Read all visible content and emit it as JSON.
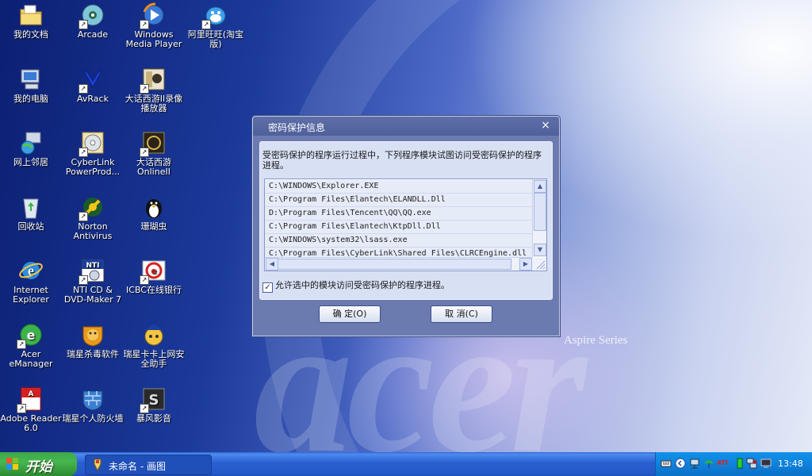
{
  "desktop": {
    "brand_text": "Aspire Series",
    "icons": [
      {
        "name": "my-documents",
        "label": "我的文档"
      },
      {
        "name": "arcade",
        "label": "Arcade"
      },
      {
        "name": "windows-media-player",
        "label": "Windows Media Player"
      },
      {
        "name": "aliwangwang",
        "label": "阿里旺旺(淘宝版)"
      },
      {
        "name": "my-computer",
        "label": "我的电脑"
      },
      {
        "name": "avrack",
        "label": "AvRack"
      },
      {
        "name": "dahuaxiyou-recorder",
        "label": "大话西游II录像播放器"
      },
      {
        "name": "network-places",
        "label": "网上邻居"
      },
      {
        "name": "cyberlink-powerproducer",
        "label": "CyberLink PowerProd..."
      },
      {
        "name": "dahuaxiyou-online",
        "label": "大话西游 OnlineII"
      },
      {
        "name": "recycle-bin",
        "label": "回收站"
      },
      {
        "name": "norton-antivirus",
        "label": "Norton Antivirus"
      },
      {
        "name": "shanhuchong",
        "label": "珊瑚虫"
      },
      {
        "name": "internet-explorer",
        "label": "Internet Explorer"
      },
      {
        "name": "nti-cd-dvd-maker",
        "label": "NTI CD & DVD-Maker 7"
      },
      {
        "name": "icbc-online-bank",
        "label": "ICBC在线银行"
      },
      {
        "name": "acer-emanager",
        "label": "Acer eManager"
      },
      {
        "name": "rising-antivirus",
        "label": "瑞星杀毒软件"
      },
      {
        "name": "rising-kaka",
        "label": "瑞星卡卡上网安全助手"
      },
      {
        "name": "adobe-reader",
        "label": "Adobe Reader 6.0"
      },
      {
        "name": "rising-firewall",
        "label": "瑞星个人防火墙"
      },
      {
        "name": "baofeng-player",
        "label": "暴风影音"
      }
    ]
  },
  "dialog": {
    "title": "密码保护信息",
    "close_glyph": "×",
    "description": "受密码保护的程序运行过程中，下列程序模块试图访问受密码保护的程序进程。",
    "modules": [
      "C:\\WINDOWS\\Explorer.EXE",
      "C:\\Program Files\\Elantech\\ELANDLL.Dll",
      "D:\\Program Files\\Tencent\\QQ\\QQ.exe",
      "C:\\Program Files\\Elantech\\KtpDll.Dll",
      "C:\\WINDOWS\\system32\\lsass.exe",
      "C:\\Program Files\\CyberLink\\Shared Files\\CLRCEngine.dll"
    ],
    "allow_checkbox": {
      "checked": true,
      "label": "允许选中的模块访问受密码保护的程序进程。"
    },
    "ok_label": "确 定(O)",
    "cancel_label": "取 消(C)"
  },
  "taskbar": {
    "start_label": "开始",
    "task_label": "未命名 - 画图",
    "clock": "13:48",
    "ati_label": "ATI"
  }
}
